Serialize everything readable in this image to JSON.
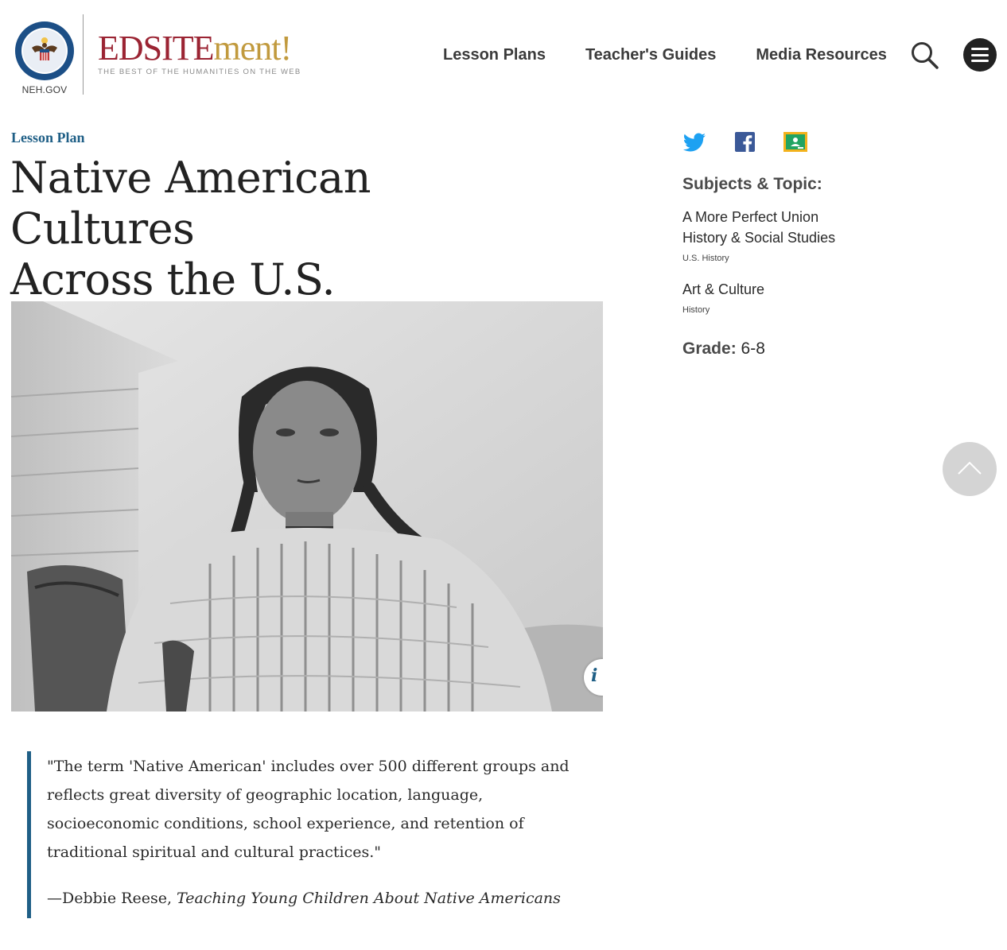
{
  "header": {
    "neh_label": "NEH.GOV",
    "brand_part1": "EDSITE",
    "brand_part2": "ment!",
    "brand_tagline": "THE BEST OF THE HUMANITIES ON THE WEB",
    "nav": [
      "Lesson Plans",
      "Teacher's Guides",
      "Media Resources"
    ],
    "search_icon": "search-icon",
    "menu_icon": "hamburger-menu-icon"
  },
  "article": {
    "eyebrow": "Lesson Plan",
    "title_line1": "Native American Cultures",
    "title_line2": "Across the U.S.",
    "hero_image": "Black and white portrait of a Native American woman in a fringed dress with long braids",
    "quote": "\"The term 'Native American' includes over 500 different groups and reflects great diversity of geographic location, language, socioeconomic conditions, school experience, and retention of traditional spiritual and cultural practices.\"",
    "cite_author": "—Debbie Reese, ",
    "cite_work": "Teaching Young Children About Native Americans"
  },
  "sidebar": {
    "share_icons": [
      "twitter-icon",
      "facebook-icon",
      "google-classroom-icon"
    ],
    "subjects_heading": "Subjects & Topic:",
    "topics": [
      {
        "lines": [
          "A More Perfect Union",
          "History & Social Studies"
        ],
        "sub": "U.S. History"
      },
      {
        "lines": [
          "Art & Culture"
        ],
        "sub": "History"
      }
    ],
    "grade_label": "Grade:",
    "grade_value": " 6-8"
  },
  "colors": {
    "accent_blue": "#1f5f86",
    "brand_red": "#9b2433",
    "brand_gold": "#c19a3e",
    "twitter_blue": "#1da1f2",
    "facebook_blue": "#3b5998",
    "classroom_yellow": "#f3b21c",
    "classroom_green": "#21a462"
  }
}
